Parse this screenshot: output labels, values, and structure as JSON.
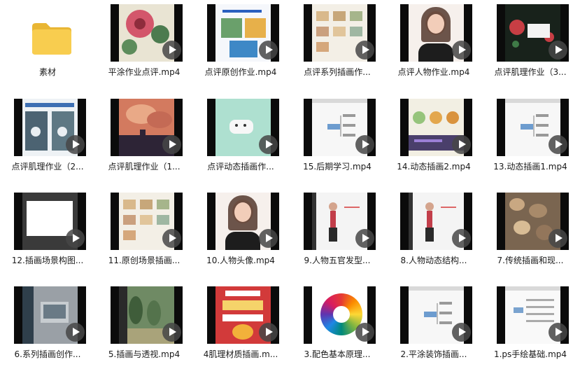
{
  "folder": {
    "label": "素材",
    "color": "#f6c744"
  },
  "files": [
    {
      "label": "平涂作业点评.mp4",
      "theme": "flower"
    },
    {
      "label": "点评原创作业.mp4",
      "theme": "page"
    },
    {
      "label": "点评系列插画作...",
      "theme": "grid"
    },
    {
      "label": "点评人物作业.mp4",
      "theme": "portrait"
    },
    {
      "label": "点评肌理作业（3...",
      "theme": "dark"
    },
    {
      "label": "点评肌理作业（2...",
      "theme": "poster"
    },
    {
      "label": "点评肌理作业（1...",
      "theme": "sunset"
    },
    {
      "label": "点评动态插画作...",
      "theme": "mint"
    },
    {
      "label": "15.后期学习.mp4",
      "theme": "mind"
    },
    {
      "label": "14.动态插画2.mp4",
      "theme": "anim"
    },
    {
      "label": "13.动态插画1.mp4",
      "theme": "mind"
    },
    {
      "label": "12.插画场景构图...",
      "theme": "blank"
    },
    {
      "label": "11.原创场景插画...",
      "theme": "grid"
    },
    {
      "label": "10.人物头像.mp4",
      "theme": "portrait"
    },
    {
      "label": "9.人物五官发型...",
      "theme": "sketch"
    },
    {
      "label": "8.人物动态结构...",
      "theme": "sketch"
    },
    {
      "label": "7.传统插画和现...",
      "theme": "texture"
    },
    {
      "label": "6.系列插画创作...",
      "theme": "gray"
    },
    {
      "label": "5.插画与透视.mp4",
      "theme": "forest"
    },
    {
      "label": "4肌理材质插画.m...",
      "theme": "redposter"
    },
    {
      "label": "3.配色基本原理...",
      "theme": "wheel"
    },
    {
      "label": "2.平涂装饰插画...",
      "theme": "mind"
    },
    {
      "label": "1.ps手绘基础.mp4",
      "theme": "table"
    }
  ],
  "icons": {
    "folder": "folder-icon",
    "play": "play-icon"
  }
}
